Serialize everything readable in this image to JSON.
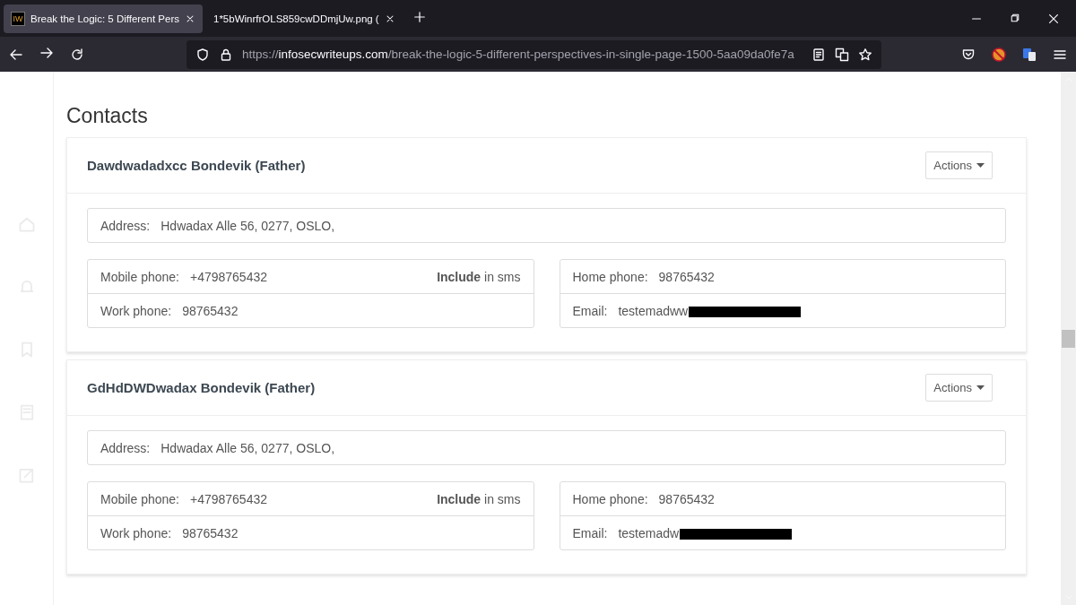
{
  "browser": {
    "tabs": [
      {
        "title": "Break the Logic: 5 Different Pers",
        "selected": true,
        "favicon": "IW"
      },
      {
        "title": "1*5bWinrfrOLS859cwDDmjUw.png (",
        "selected": false
      }
    ],
    "url": {
      "scheme": "https://",
      "host": "infosecwriteups.com",
      "path": "/break-the-logic-5-different-perspectives-in-single-page-1500-5aa09da0fe7a"
    }
  },
  "page": {
    "title": "Contacts",
    "contacts": [
      {
        "name": "Dawdwadadxcc Bondevik (Father)",
        "actions": "Actions",
        "address_label": "Address:",
        "address": "Hdwadax Alle 56, 0277, OSLO,",
        "mobile_label": "Mobile phone:",
        "mobile": "+4798765432",
        "sms": "**Include** in sms",
        "work_label": "Work phone:",
        "work": "98765432",
        "home_label": "Home phone:",
        "home": "98765432",
        "email_label": "Email:",
        "email": "testemadww"
      },
      {
        "name": "GdHdDWDwadax Bondevik (Father)",
        "actions": "Actions",
        "address_label": "Address:",
        "address": "Hdwadax Alle 56, 0277, OSLO,",
        "mobile_label": "Mobile phone:",
        "mobile": "+4798765432",
        "sms": "**Include** in sms",
        "work_label": "Work phone:",
        "work": "98765432",
        "home_label": "Home phone:",
        "home": "98765432",
        "email_label": "Email:",
        "email": "testemadw"
      }
    ]
  }
}
